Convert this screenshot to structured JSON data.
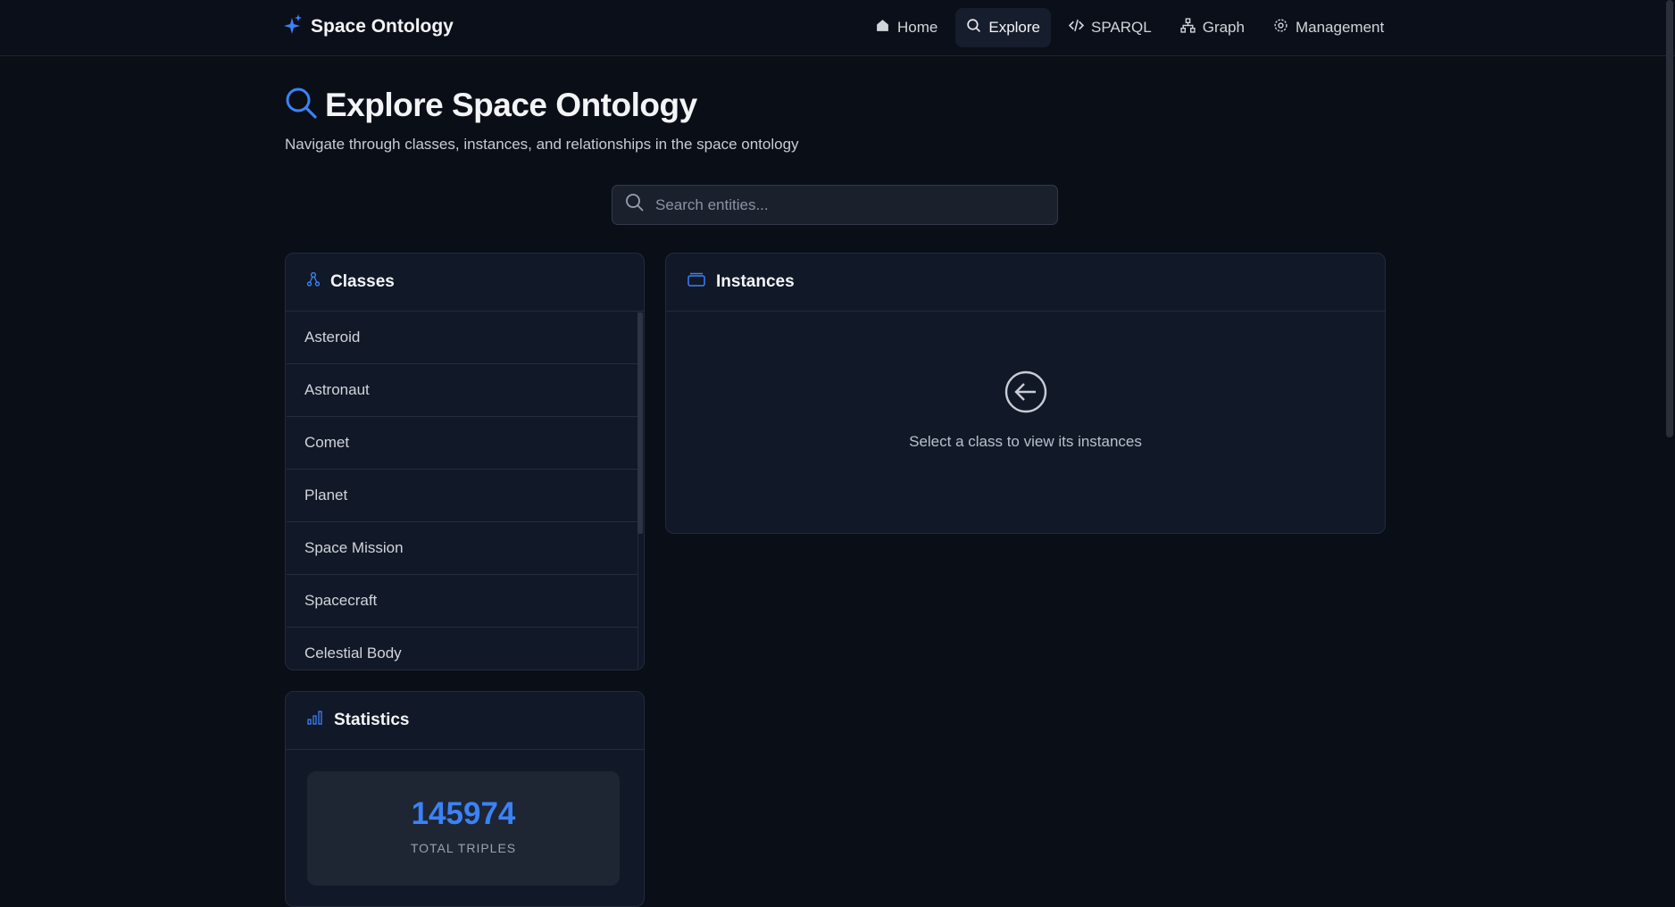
{
  "brand": {
    "name": "Space Ontology"
  },
  "nav": {
    "items": [
      {
        "label": "Home",
        "icon": "home-icon"
      },
      {
        "label": "Explore",
        "icon": "search-icon",
        "active": true
      },
      {
        "label": "SPARQL",
        "icon": "code-icon"
      },
      {
        "label": "Graph",
        "icon": "graph-icon"
      },
      {
        "label": "Management",
        "icon": "gear-icon"
      }
    ]
  },
  "page": {
    "title": "Explore Space Ontology",
    "subtitle": "Navigate through classes, instances, and relationships in the space ontology"
  },
  "search": {
    "placeholder": "Search entities...",
    "value": ""
  },
  "classes": {
    "title": "Classes",
    "items": [
      {
        "label": "Asteroid"
      },
      {
        "label": "Astronaut"
      },
      {
        "label": "Comet"
      },
      {
        "label": "Planet"
      },
      {
        "label": "Space Mission"
      },
      {
        "label": "Spacecraft"
      },
      {
        "label": "Celestial Body"
      }
    ]
  },
  "instances": {
    "title": "Instances",
    "empty_message": "Select a class to view its instances"
  },
  "statistics": {
    "title": "Statistics",
    "total_triples": "145974",
    "total_triples_label": "TOTAL TRIPLES"
  },
  "colors": {
    "accent": "#3b82f6",
    "background": "#0a0e17",
    "panel": "#111827"
  }
}
